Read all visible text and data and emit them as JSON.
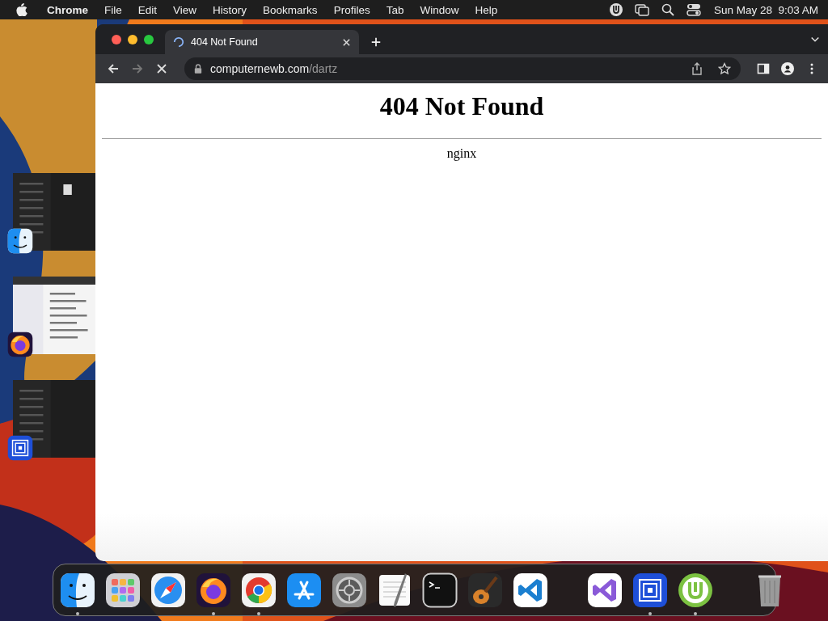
{
  "menu_bar": {
    "app": "Chrome",
    "menus": [
      "File",
      "Edit",
      "View",
      "History",
      "Bookmarks",
      "Profiles",
      "Tab",
      "Window",
      "Help"
    ],
    "clock": "Sun May 28  9:03 AM"
  },
  "stage_manager": [
    {
      "kind": "finder"
    },
    {
      "kind": "firefox"
    },
    {
      "kind": "remote"
    }
  ],
  "browser": {
    "tabs": [
      {
        "title": "404 Not Found",
        "loading": true,
        "selected": true
      }
    ],
    "address": {
      "host": "computernewb.com",
      "path": "/dartz"
    },
    "loading": true,
    "page": {
      "heading": "404 Not Found",
      "footer": "nginx"
    }
  },
  "dock": [
    {
      "kind": "finder",
      "running": true
    },
    {
      "kind": "launchpad",
      "running": false
    },
    {
      "kind": "safari",
      "running": false
    },
    {
      "kind": "firefox",
      "running": true
    },
    {
      "kind": "chrome",
      "running": true
    },
    {
      "kind": "appstore",
      "running": false
    },
    {
      "kind": "settings",
      "running": false
    },
    {
      "kind": "textedit",
      "running": false
    },
    {
      "kind": "terminal",
      "running": false
    },
    {
      "kind": "guitar",
      "running": false
    },
    {
      "kind": "vscode",
      "running": false
    },
    {
      "kind": "separator"
    },
    {
      "kind": "visualstudio",
      "running": false
    },
    {
      "kind": "remote",
      "running": true
    },
    {
      "kind": "torrent",
      "running": true
    },
    {
      "kind": "separator"
    },
    {
      "kind": "trash",
      "running": false
    }
  ]
}
